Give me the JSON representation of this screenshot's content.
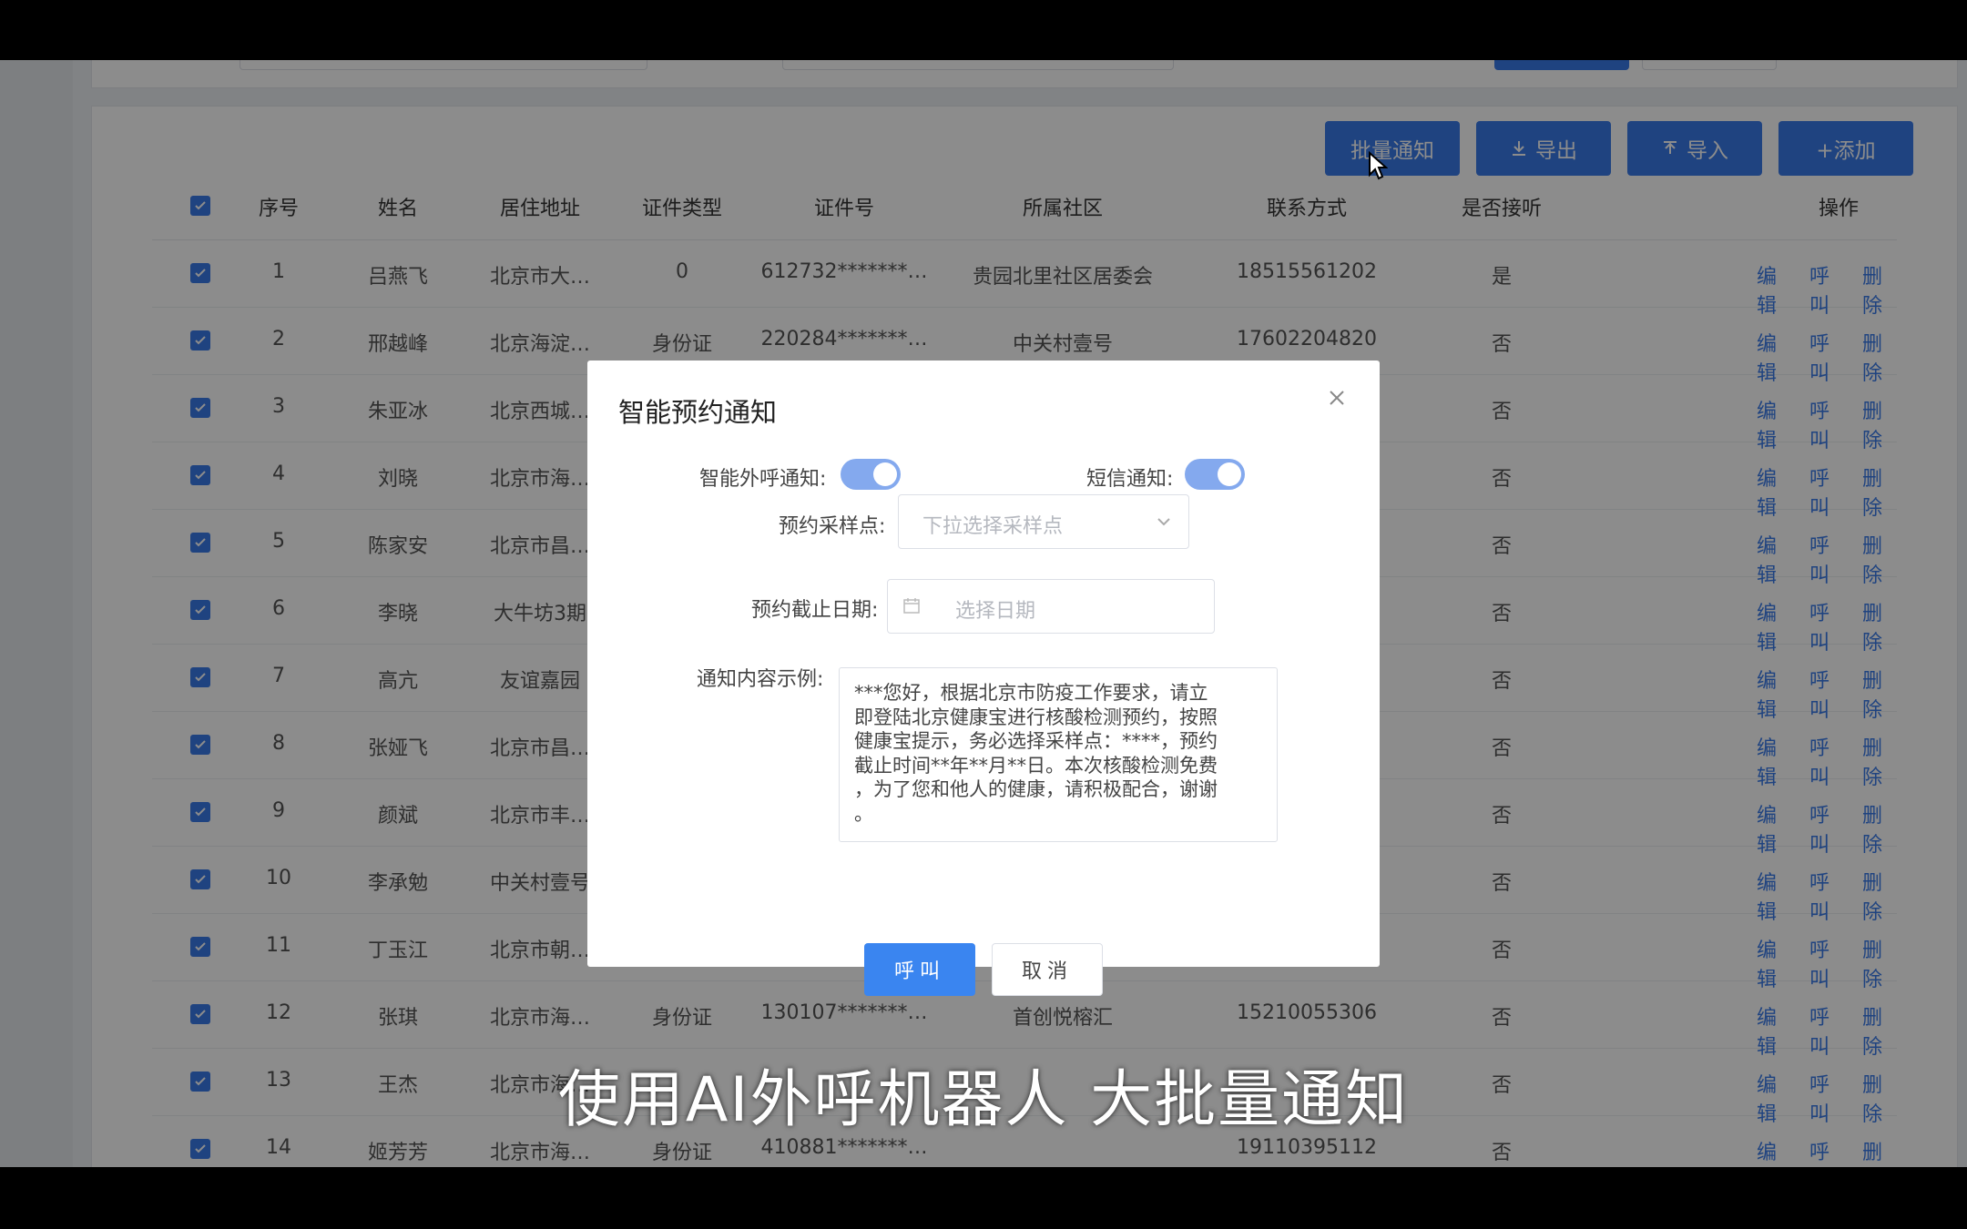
{
  "toolbar": {
    "batch_notify": "批量通知",
    "export": "导出",
    "import": "导入",
    "add": "+添加"
  },
  "table": {
    "columns": [
      "序号",
      "姓名",
      "居住地址",
      "证件类型",
      "证件号",
      "所属社区",
      "联系方式",
      "是否接听",
      "操作"
    ],
    "ops": [
      "编辑",
      "呼叫",
      "删除"
    ],
    "rows": [
      {
        "no": "1",
        "name": "吕燕飞",
        "addr": "北京市大…",
        "idtype": "0",
        "idno": "612732*******…",
        "community": "贵园北里社区居委会",
        "phone": "18515561202",
        "answered": "是"
      },
      {
        "no": "2",
        "name": "邢越峰",
        "addr": "北京海淀…",
        "idtype": "身份证",
        "idno": "220284*******…",
        "community": "中关村壹号",
        "phone": "17602204820",
        "answered": "否"
      },
      {
        "no": "3",
        "name": "朱亚冰",
        "addr": "北京西城…",
        "idtype": "",
        "idno": "",
        "community": "",
        "phone": "",
        "answered": "否"
      },
      {
        "no": "4",
        "name": "刘晓",
        "addr": "北京市海…",
        "idtype": "",
        "idno": "",
        "community": "",
        "phone": "",
        "answered": "否"
      },
      {
        "no": "5",
        "name": "陈家安",
        "addr": "北京市昌…",
        "idtype": "",
        "idno": "",
        "community": "",
        "phone": "",
        "answered": "否"
      },
      {
        "no": "6",
        "name": "李晓",
        "addr": "大牛坊3期",
        "idtype": "",
        "idno": "",
        "community": "",
        "phone": "",
        "answered": "否"
      },
      {
        "no": "7",
        "name": "高亢",
        "addr": "友谊嘉园",
        "idtype": "",
        "idno": "",
        "community": "",
        "phone": "",
        "answered": "否"
      },
      {
        "no": "8",
        "name": "张娅飞",
        "addr": "北京市昌…",
        "idtype": "",
        "idno": "",
        "community": "",
        "phone": "",
        "answered": "否"
      },
      {
        "no": "9",
        "name": "颜斌",
        "addr": "北京市丰…",
        "idtype": "",
        "idno": "",
        "community": "",
        "phone": "",
        "answered": "否"
      },
      {
        "no": "10",
        "name": "李承勉",
        "addr": "中关村壹号",
        "idtype": "",
        "idno": "",
        "community": "",
        "phone": "",
        "answered": "否"
      },
      {
        "no": "11",
        "name": "丁玉江",
        "addr": "北京市朝…",
        "idtype": "",
        "idno": "",
        "community": "",
        "phone": "",
        "answered": "否"
      },
      {
        "no": "12",
        "name": "张琪",
        "addr": "北京市海…",
        "idtype": "身份证",
        "idno": "130107*******…",
        "community": "首创悦榕汇",
        "phone": "15210055306",
        "answered": "否"
      },
      {
        "no": "13",
        "name": "王杰",
        "addr": "北京市海…",
        "idtype": "",
        "idno": "",
        "community": "",
        "phone": "",
        "answered": "否"
      },
      {
        "no": "14",
        "name": "姬芳芳",
        "addr": "北京市海…",
        "idtype": "身份证",
        "idno": "410881*******…",
        "community": "",
        "phone": "19110395112",
        "answered": "否"
      }
    ]
  },
  "modal": {
    "title": "智能预约通知",
    "ai_call_label": "智能外呼通知:",
    "sms_label": "短信通知:",
    "ai_call_on": true,
    "sms_on": true,
    "site_label": "预约采样点:",
    "site_placeholder": "下拉选择采样点",
    "deadline_label": "预约截止日期:",
    "deadline_placeholder": "选择日期",
    "content_label": "通知内容示例:",
    "content_lines": [
      "***您好，根据北京市防疫工作要求，请立",
      "即登陆北京健康宝进行核酸检测预约，按照",
      "健康宝提示，务必选择采样点：****，预约",
      "截止时间**年**月**日。本次核酸检测免费",
      "，为了您和他人的健康，请积极配合，谢谢",
      "。"
    ],
    "call_button": "呼叫",
    "cancel_button": "取消"
  },
  "subtitle": "使用AI外呼机器人 大批量通知",
  "colors": {
    "primary": "#3a7bea",
    "switch_on": "#84a9ee"
  }
}
